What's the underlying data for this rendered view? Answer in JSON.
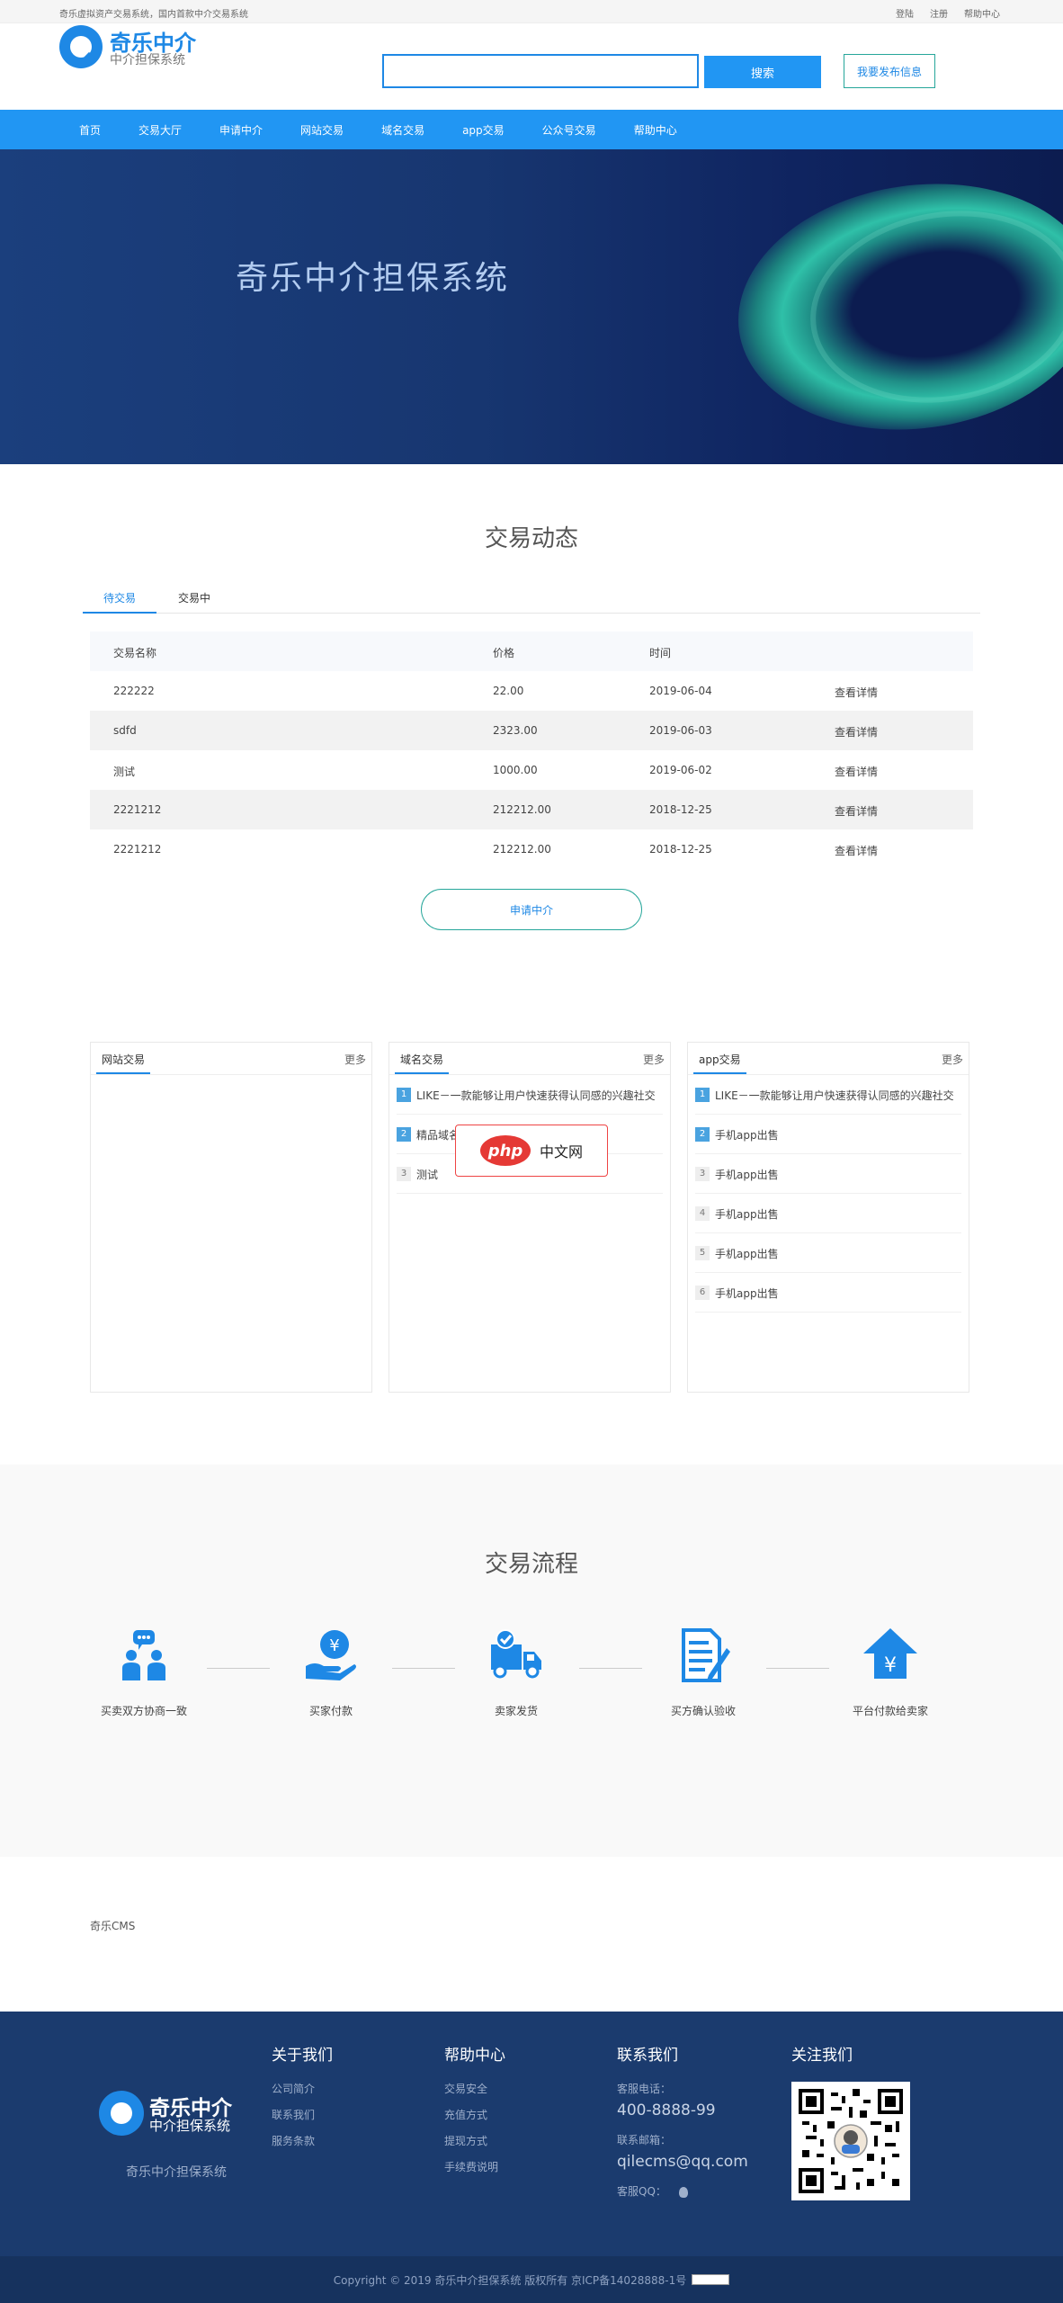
{
  "topbar": {
    "slogan": "奇乐虚拟资产交易系统，国内首款中介交易系统",
    "login": "登陆",
    "register": "注册",
    "help": "帮助中心"
  },
  "header": {
    "logo_main": "奇乐中介",
    "logo_sub": "中介担保系统",
    "search_value": "",
    "search_button": "搜索",
    "publish_button": "我要发布信息"
  },
  "nav": [
    "首页",
    "交易大厅",
    "申请中介",
    "网站交易",
    "域名交易",
    "app交易",
    "公众号交易",
    "帮助中心"
  ],
  "banner": {
    "title": "奇乐中介担保系统"
  },
  "trade": {
    "title": "交易动态",
    "tabs": [
      "待交易",
      "交易中"
    ],
    "headers": [
      "交易名称",
      "价格",
      "时间"
    ],
    "rows": [
      {
        "name": "222222",
        "price": "22.00",
        "time": "2019-06-04",
        "action": "查看详情"
      },
      {
        "name": "sdfd",
        "price": "2323.00",
        "time": "2019-06-03",
        "action": "查看详情"
      },
      {
        "name": "测试",
        "price": "1000.00",
        "time": "2019-06-02",
        "action": "查看详情"
      },
      {
        "name": "2221212",
        "price": "212212.00",
        "time": "2018-12-25",
        "action": "查看详情"
      },
      {
        "name": "2221212",
        "price": "212212.00",
        "time": "2018-12-25",
        "action": "查看详情"
      }
    ],
    "apply_button": "申请中介"
  },
  "panels": [
    {
      "title": "网站交易",
      "more": "更多",
      "items": []
    },
    {
      "title": "域名交易",
      "more": "更多",
      "items": [
        {
          "num": "1",
          "text": "LIKE－一款能够让用户快速获得认同感的兴趣社交"
        },
        {
          "num": "2",
          "text": "精品域名"
        },
        {
          "num": "3",
          "text": "测试"
        }
      ]
    },
    {
      "title": "app交易",
      "more": "更多",
      "items": [
        {
          "num": "1",
          "text": "LIKE－一款能够让用户快速获得认同感的兴趣社交"
        },
        {
          "num": "2",
          "text": "手机app出售"
        },
        {
          "num": "3",
          "text": "手机app出售"
        },
        {
          "num": "4",
          "text": "手机app出售"
        },
        {
          "num": "5",
          "text": "手机app出售"
        },
        {
          "num": "6",
          "text": "手机app出售"
        }
      ]
    }
  ],
  "watermark": {
    "logo": "php",
    "text": "中文网"
  },
  "flow": {
    "title": "交易流程",
    "steps": [
      "买卖双方协商一致",
      "买家付款",
      "卖家发货",
      "买方确认验收",
      "平台付款给卖家"
    ],
    "step_icons": [
      "handshake-users-icon",
      "yen-payment-icon",
      "delivery-truck-icon",
      "document-check-icon",
      "upload-yen-icon"
    ]
  },
  "links": {
    "item": "奇乐CMS"
  },
  "footer": {
    "logo_main": "奇乐中介",
    "logo_sub": "中介担保系统",
    "slogan": "奇乐中介担保系统",
    "about": {
      "title": "关于我们",
      "items": [
        "公司简介",
        "联系我们",
        "服务条款"
      ]
    },
    "help": {
      "title": "帮助中心",
      "items": [
        "交易安全",
        "充值方式",
        "提现方式",
        "手续费说明"
      ]
    },
    "contact": {
      "title": "联系我们",
      "phone_label": "客服电话：",
      "phone": "400-8888-99",
      "email_label": "联系邮箱：",
      "email": "qilecms@qq.com",
      "qq_label": "客服QQ："
    },
    "follow": {
      "title": "关注我们"
    },
    "copyright": "Copyright © 2019 奇乐中介担保系统 版权所有 京ICP备14028888-1号"
  },
  "colors": {
    "primary": "#2196f3",
    "footer": "#1b3b6e",
    "accent": "#26a69a"
  }
}
